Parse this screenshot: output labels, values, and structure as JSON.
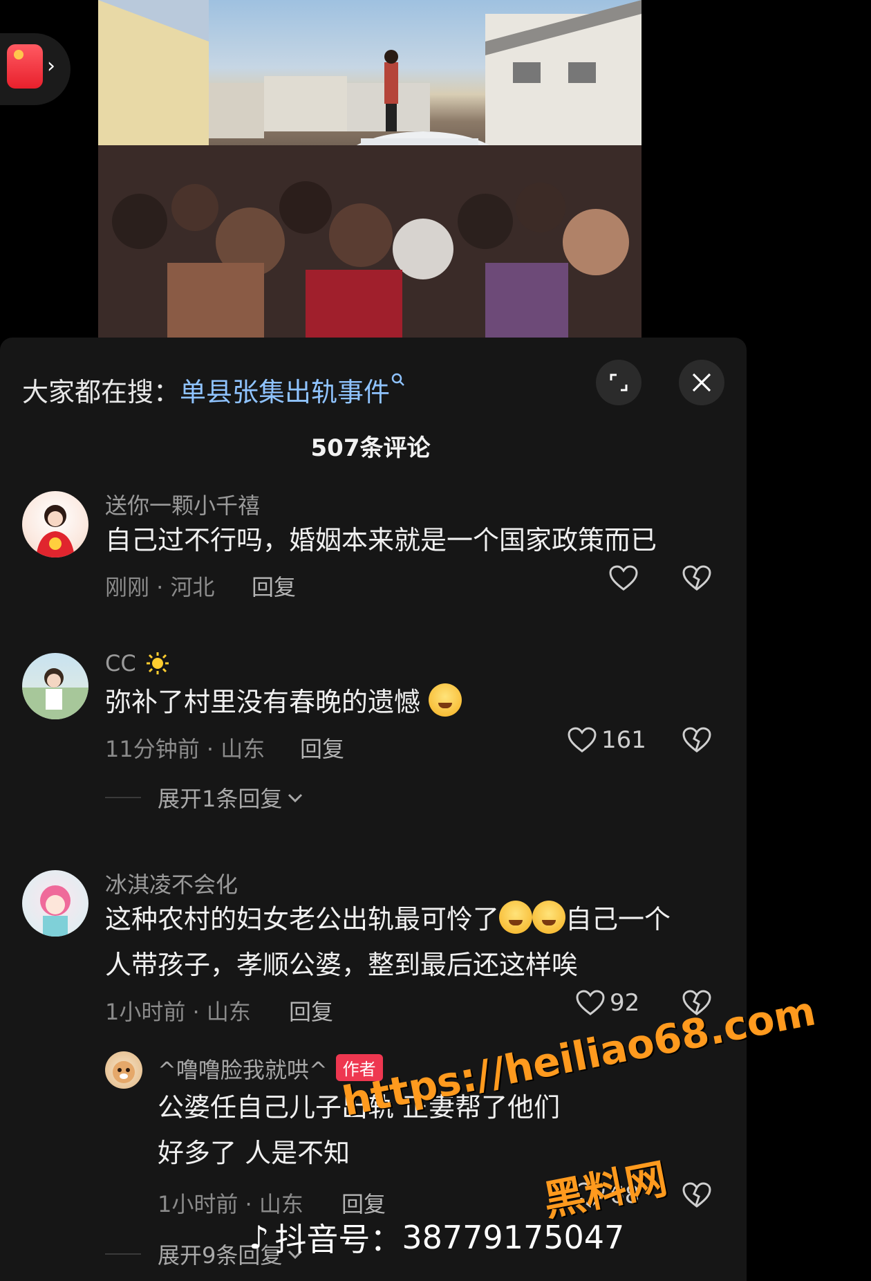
{
  "panel": {
    "search_prefix": "大家都在搜：",
    "search_term": "单县张集出轨事件",
    "comment_count_title": "507条评论"
  },
  "comments": [
    {
      "username": "送你一颗小千禧",
      "text": "自己过不行吗，婚姻本来就是一个国家政策而已",
      "meta": "刚刚 · 河北",
      "reply_label": "回复",
      "likes": ""
    },
    {
      "username": "CC",
      "text": "弥补了村里没有春晚的遗憾",
      "meta": "11分钟前 · 山东",
      "reply_label": "回复",
      "likes": "161",
      "expand_label": "展开1条回复"
    },
    {
      "username": "冰淇凌不会化",
      "text_line1": "这种农村的妇女老公出轨最可怜了",
      "text_line1_tail": "自己一个",
      "text_line2": "人带孩子，孝顺公婆，整到最后还这样唉",
      "meta": "1小时前 · 山东",
      "reply_label": "回复",
      "likes": "92"
    }
  ],
  "reply": {
    "username": "^噜噜脸我就哄^",
    "badge": "作者",
    "text_line1": "公婆任自己儿子出轨 正妻帮了他们",
    "text_line2": "好多了 人是不知",
    "meta": "1小时前 · 山东",
    "reply_label": "回复",
    "likes": "68",
    "expand_label": "展开9条回复"
  },
  "watermarks": {
    "url": "https://heiliao68.com",
    "site": "黑料网",
    "douyin_label": "抖音号：",
    "douyin_id": "38779175047"
  },
  "icons": [
    "red-packet-icon",
    "chevron-right-icon",
    "expand-icon",
    "close-icon",
    "search-icon",
    "heart-icon",
    "broken-heart-icon",
    "chevron-down-icon",
    "douyin-logo-icon"
  ]
}
